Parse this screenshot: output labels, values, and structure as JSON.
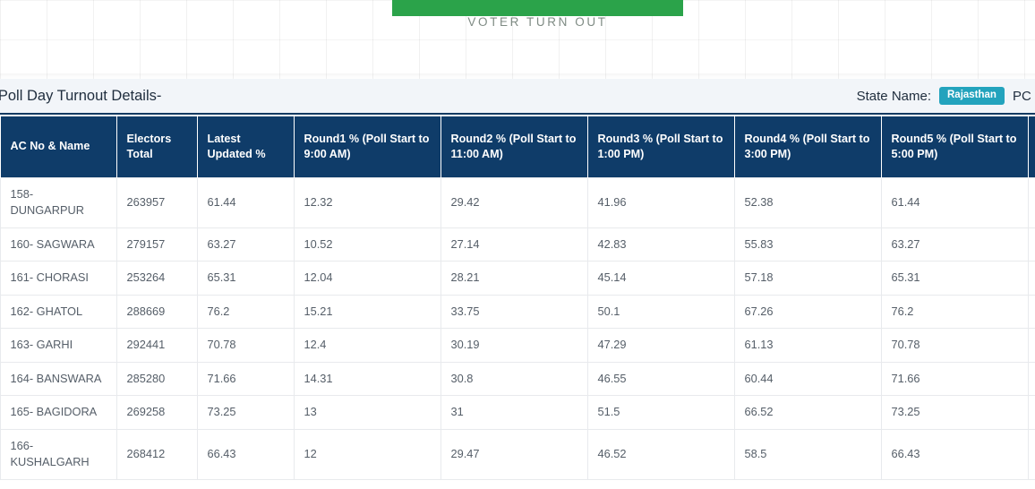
{
  "banner": {
    "caption": "VOTER TURN OUT",
    "bar_color": "#2ba34a"
  },
  "details_header": {
    "title": "nated Poll Day Turnout Details-",
    "state_label": "State Name:",
    "state_value": "Rajasthan",
    "state_badge_color": "#23a3bd",
    "pc_label": "PC Name"
  },
  "table": {
    "header_color": "#0f3c69",
    "columns": [
      "AC No & Name",
      "Electors Total",
      "Latest Updated %",
      "Round1 % (Poll Start to 9:00 AM)",
      "Round2 % (Poll Start to 11:00 AM)",
      "Round3 % (Poll Start to 1:00 PM)",
      "Round4 % (Poll Start to 3:00 PM)",
      "Round5 % (Poll Start to 5:00 PM)"
    ],
    "rows": [
      {
        "ac": "158- DUNGARPUR",
        "electors": "263957",
        "latest": "61.44",
        "r1": "12.32",
        "r2": "29.42",
        "r3": "41.96",
        "r4": "52.38",
        "r5": "61.44"
      },
      {
        "ac": "160- SAGWARA",
        "electors": "279157",
        "latest": "63.27",
        "r1": "10.52",
        "r2": "27.14",
        "r3": "42.83",
        "r4": "55.83",
        "r5": "63.27"
      },
      {
        "ac": "161- CHORASI",
        "electors": "253264",
        "latest": "65.31",
        "r1": "12.04",
        "r2": "28.21",
        "r3": "45.14",
        "r4": "57.18",
        "r5": "65.31"
      },
      {
        "ac": "162- GHATOL",
        "electors": "288669",
        "latest": "76.2",
        "r1": "15.21",
        "r2": "33.75",
        "r3": "50.1",
        "r4": "67.26",
        "r5": "76.2"
      },
      {
        "ac": "163- GARHI",
        "electors": "292441",
        "latest": "70.78",
        "r1": "12.4",
        "r2": "30.19",
        "r3": "47.29",
        "r4": "61.13",
        "r5": "70.78"
      },
      {
        "ac": "164- BANSWARA",
        "electors": "285280",
        "latest": "71.66",
        "r1": "14.31",
        "r2": "30.8",
        "r3": "46.55",
        "r4": "60.44",
        "r5": "71.66"
      },
      {
        "ac": "165- BAGIDORA",
        "electors": "269258",
        "latest": "73.25",
        "r1": "13",
        "r2": "31",
        "r3": "51.5",
        "r4": "66.52",
        "r5": "73.25"
      },
      {
        "ac": "166- KUSHALGARH",
        "electors": "268412",
        "latest": "66.43",
        "r1": "12",
        "r2": "29.47",
        "r3": "46.52",
        "r4": "58.5",
        "r5": "66.43"
      }
    ]
  }
}
